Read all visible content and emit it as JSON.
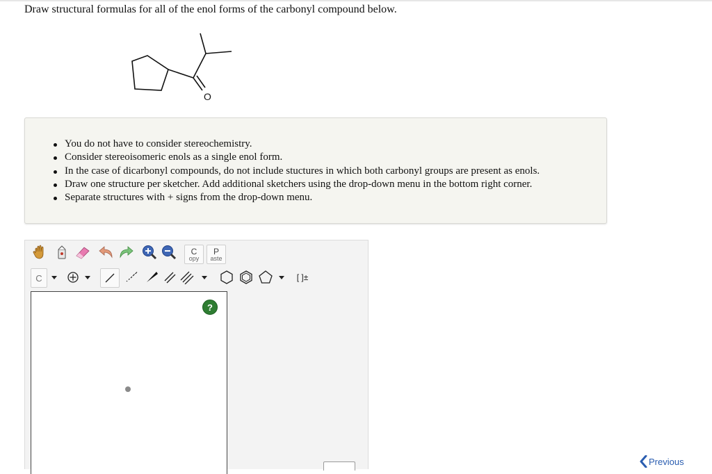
{
  "question": {
    "text": "Draw structural formulas for all of the enol forms of the carbonyl compound below."
  },
  "molecule": {
    "atom_label": "O"
  },
  "instructions": {
    "items": [
      "You do not have to consider stereochemistry.",
      "Consider stereoisomeric enols as a single enol form.",
      "In the case of dicarbonyl compounds, do not include stuctures in which both carbonyl groups are present as enols.",
      "Draw one structure per sketcher. Add additional sketchers using the drop-down menu in the bottom right corner.",
      "Separate structures with + signs from the drop-down menu."
    ]
  },
  "toolbar": {
    "copy_big": "C",
    "copy_small": "opy",
    "paste_big": "P",
    "paste_small": "aste",
    "element_label": "C",
    "bracket_label": "[ ]±"
  },
  "help": {
    "label": "?"
  },
  "nav": {
    "previous_label": "Previous"
  }
}
